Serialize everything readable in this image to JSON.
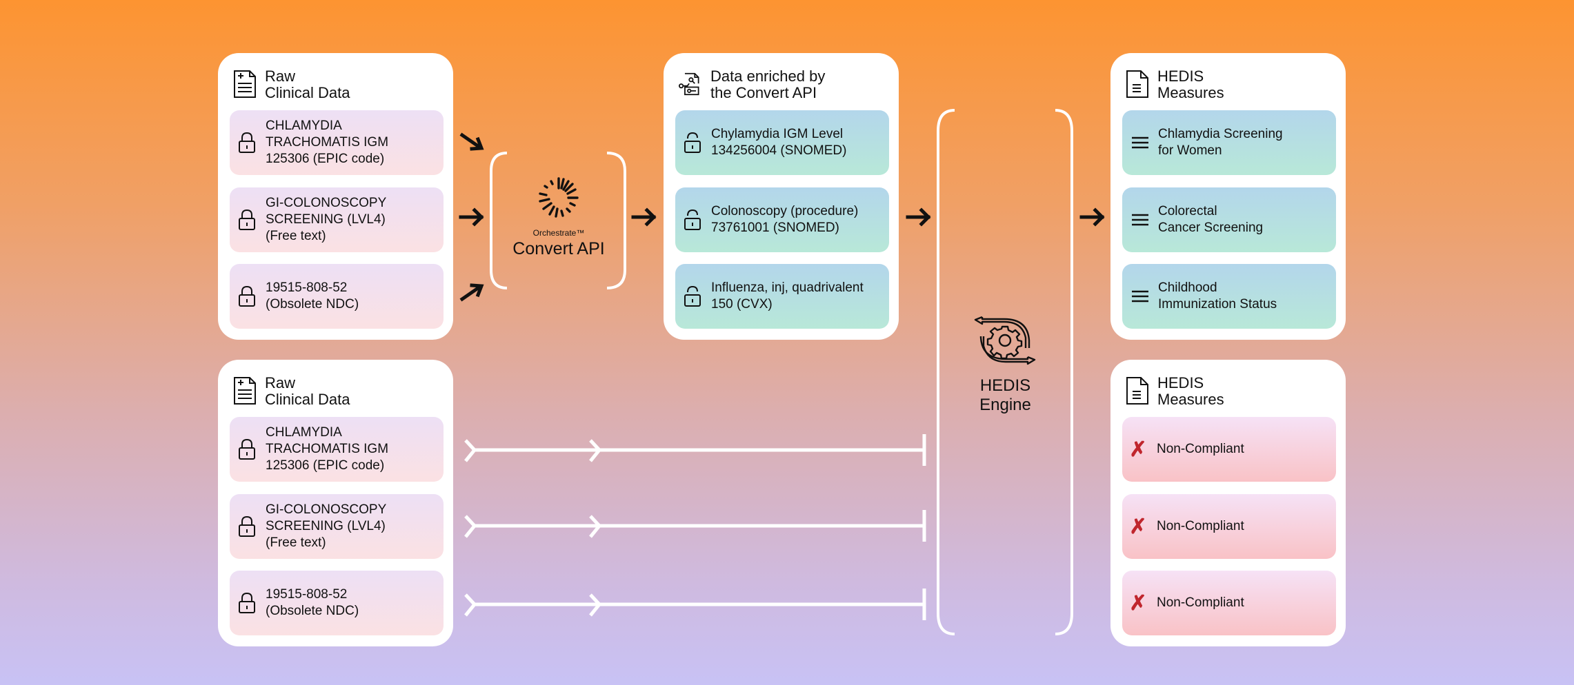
{
  "raw_top": {
    "title": "Raw\nClinical Data",
    "items": [
      {
        "text": "CHLAMYDIA\nTRACHOMATIS IGM\n125306 (EPIC code)",
        "icon": "lock-closed-icon"
      },
      {
        "text": "GI-COLONOSCOPY\nSCREENING (LVL4)\n(Free text)",
        "icon": "lock-closed-icon"
      },
      {
        "text": "19515-808-52\n(Obsolete NDC)",
        "icon": "lock-closed-icon"
      }
    ]
  },
  "convert_api": {
    "brand": "Orchestrate™",
    "name": "Convert API"
  },
  "enriched": {
    "title": "Data enriched by\nthe Convert API",
    "items": [
      {
        "text": "Chylamydia IGM Level\n134256004 (SNOMED)",
        "icon": "lock-open-icon"
      },
      {
        "text": "Colonoscopy (procedure)\n73761001 (SNOMED)",
        "icon": "lock-open-icon"
      },
      {
        "text": "Influenza, inj, quadrivalent\n150 (CVX)",
        "icon": "lock-open-icon"
      }
    ]
  },
  "engine": {
    "label": "HEDIS\nEngine"
  },
  "hedis_top": {
    "title": "HEDIS\nMeasures",
    "items": [
      {
        "text": "Chlamydia Screening\nfor Women",
        "icon": "menu-lines-icon"
      },
      {
        "text": "Colorectal\nCancer Screening",
        "icon": "menu-lines-icon"
      },
      {
        "text": "Childhood\nImmunization Status",
        "icon": "menu-lines-icon"
      }
    ]
  },
  "raw_bottom": {
    "title": "Raw\nClinical Data",
    "items": [
      {
        "text": "CHLAMYDIA\nTRACHOMATIS IGM\n125306 (EPIC code)",
        "icon": "lock-closed-icon"
      },
      {
        "text": "GI-COLONOSCOPY\nSCREENING (LVL4)\n(Free text)",
        "icon": "lock-closed-icon"
      },
      {
        "text": "19515-808-52\n(Obsolete NDC)",
        "icon": "lock-closed-icon"
      }
    ]
  },
  "hedis_bottom": {
    "title": "HEDIS\nMeasures",
    "items": [
      {
        "text": "Non-Compliant",
        "icon": "x-mark-icon"
      },
      {
        "text": "Non-Compliant",
        "icon": "x-mark-icon"
      },
      {
        "text": "Non-Compliant",
        "icon": "x-mark-icon"
      }
    ]
  },
  "colors": {
    "accent_orange": "#fd9431",
    "accent_lavender": "#c8c2f5",
    "non_compliant_red": "#c0262d"
  }
}
